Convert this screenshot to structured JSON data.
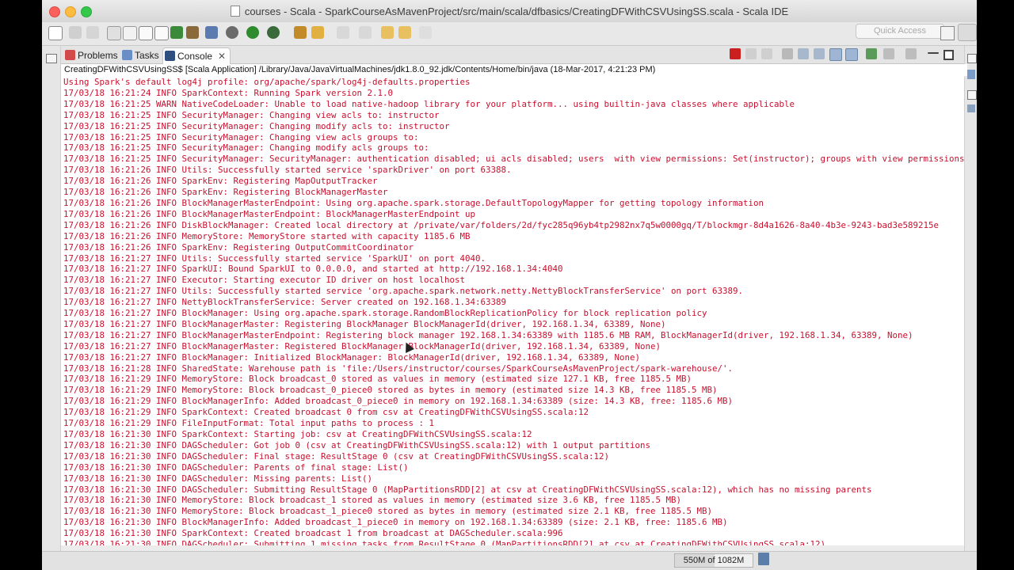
{
  "window": {
    "title": "courses - Scala - SparkCourseAsMavenProject/src/main/scala/dfbasics/CreatingDFWithCSVUsingSS.scala - Scala IDE"
  },
  "toolbar": {
    "quick_access_placeholder": "Quick Access"
  },
  "tabs": [
    {
      "label": "Problems",
      "icon": "problems-icon"
    },
    {
      "label": "Tasks",
      "icon": "tasks-icon"
    },
    {
      "label": "Console",
      "icon": "console-icon",
      "active": true
    }
  ],
  "console": {
    "launch_info": "CreatingDFWithCSVUsingSS$ [Scala Application] /Library/Java/JavaVirtualMachines/jdk1.8.0_92.jdk/Contents/Home/bin/java (18-Mar-2017, 4:21:23 PM)",
    "text_color": "#c8102e",
    "lines": [
      "Using Spark's default log4j profile: org/apache/spark/log4j-defaults.properties",
      "17/03/18 16:21:24 INFO SparkContext: Running Spark version 2.1.0",
      "17/03/18 16:21:25 WARN NativeCodeLoader: Unable to load native-hadoop library for your platform... using builtin-java classes where applicable",
      "17/03/18 16:21:25 INFO SecurityManager: Changing view acls to: instructor",
      "17/03/18 16:21:25 INFO SecurityManager: Changing modify acls to: instructor",
      "17/03/18 16:21:25 INFO SecurityManager: Changing view acls groups to:",
      "17/03/18 16:21:25 INFO SecurityManager: Changing modify acls groups to:",
      "17/03/18 16:21:25 INFO SecurityManager: SecurityManager: authentication disabled; ui acls disabled; users  with view permissions: Set(instructor); groups with view permissions",
      "17/03/18 16:21:26 INFO Utils: Successfully started service 'sparkDriver' on port 63388.",
      "17/03/18 16:21:26 INFO SparkEnv: Registering MapOutputTracker",
      "17/03/18 16:21:26 INFO SparkEnv: Registering BlockManagerMaster",
      "17/03/18 16:21:26 INFO BlockManagerMasterEndpoint: Using org.apache.spark.storage.DefaultTopologyMapper for getting topology information",
      "17/03/18 16:21:26 INFO BlockManagerMasterEndpoint: BlockManagerMasterEndpoint up",
      "17/03/18 16:21:26 INFO DiskBlockManager: Created local directory at /private/var/folders/2d/fyc285q96yb4tp2982nx7q5w0000gq/T/blockmgr-8d4a1626-8a40-4b3e-9243-bad3e589215e",
      "17/03/18 16:21:26 INFO MemoryStore: MemoryStore started with capacity 1185.6 MB",
      "17/03/18 16:21:26 INFO SparkEnv: Registering OutputCommitCoordinator",
      "17/03/18 16:21:27 INFO Utils: Successfully started service 'SparkUI' on port 4040.",
      "17/03/18 16:21:27 INFO SparkUI: Bound SparkUI to 0.0.0.0, and started at http://192.168.1.34:4040",
      "17/03/18 16:21:27 INFO Executor: Starting executor ID driver on host localhost",
      "17/03/18 16:21:27 INFO Utils: Successfully started service 'org.apache.spark.network.netty.NettyBlockTransferService' on port 63389.",
      "17/03/18 16:21:27 INFO NettyBlockTransferService: Server created on 192.168.1.34:63389",
      "17/03/18 16:21:27 INFO BlockManager: Using org.apache.spark.storage.RandomBlockReplicationPolicy for block replication policy",
      "17/03/18 16:21:27 INFO BlockManagerMaster: Registering BlockManager BlockManagerId(driver, 192.168.1.34, 63389, None)",
      "17/03/18 16:21:27 INFO BlockManagerMasterEndpoint: Registering block manager 192.168.1.34:63389 with 1185.6 MB RAM, BlockManagerId(driver, 192.168.1.34, 63389, None)",
      "17/03/18 16:21:27 INFO BlockManagerMaster: Registered BlockManager BlockManagerId(driver, 192.168.1.34, 63389, None)",
      "17/03/18 16:21:27 INFO BlockManager: Initialized BlockManager: BlockManagerId(driver, 192.168.1.34, 63389, None)",
      "17/03/18 16:21:28 INFO SharedState: Warehouse path is 'file:/Users/instructor/courses/SparkCourseAsMavenProject/spark-warehouse/'.",
      "17/03/18 16:21:29 INFO MemoryStore: Block broadcast_0 stored as values in memory (estimated size 127.1 KB, free 1185.5 MB)",
      "17/03/18 16:21:29 INFO MemoryStore: Block broadcast_0_piece0 stored as bytes in memory (estimated size 14.3 KB, free 1185.5 MB)",
      "17/03/18 16:21:29 INFO BlockManagerInfo: Added broadcast_0_piece0 in memory on 192.168.1.34:63389 (size: 14.3 KB, free: 1185.6 MB)",
      "17/03/18 16:21:29 INFO SparkContext: Created broadcast 0 from csv at CreatingDFWithCSVUsingSS.scala:12",
      "17/03/18 16:21:29 INFO FileInputFormat: Total input paths to process : 1",
      "17/03/18 16:21:30 INFO SparkContext: Starting job: csv at CreatingDFWithCSVUsingSS.scala:12",
      "17/03/18 16:21:30 INFO DAGScheduler: Got job 0 (csv at CreatingDFWithCSVUsingSS.scala:12) with 1 output partitions",
      "17/03/18 16:21:30 INFO DAGScheduler: Final stage: ResultStage 0 (csv at CreatingDFWithCSVUsingSS.scala:12)",
      "17/03/18 16:21:30 INFO DAGScheduler: Parents of final stage: List()",
      "17/03/18 16:21:30 INFO DAGScheduler: Missing parents: List()",
      "17/03/18 16:21:30 INFO DAGScheduler: Submitting ResultStage 0 (MapPartitionsRDD[2] at csv at CreatingDFWithCSVUsingSS.scala:12), which has no missing parents",
      "17/03/18 16:21:30 INFO MemoryStore: Block broadcast_1 stored as values in memory (estimated size 3.6 KB, free 1185.5 MB)",
      "17/03/18 16:21:30 INFO MemoryStore: Block broadcast_1_piece0 stored as bytes in memory (estimated size 2.1 KB, free 1185.5 MB)",
      "17/03/18 16:21:30 INFO BlockManagerInfo: Added broadcast_1_piece0 in memory on 192.168.1.34:63389 (size: 2.1 KB, free: 1185.6 MB)",
      "17/03/18 16:21:30 INFO SparkContext: Created broadcast 1 from broadcast at DAGScheduler.scala:996",
      "17/03/18 16:21:30 INFO DAGScheduler: Submitting 1 missing tasks from ResultStage 0 (MapPartitionsRDD[2] at csv at CreatingDFWithCSVUsingSS.scala:12)"
    ]
  },
  "status": {
    "heap_used": "550M",
    "heap_of": "of",
    "heap_total": "1082M",
    "heap_fraction": 0.508
  }
}
